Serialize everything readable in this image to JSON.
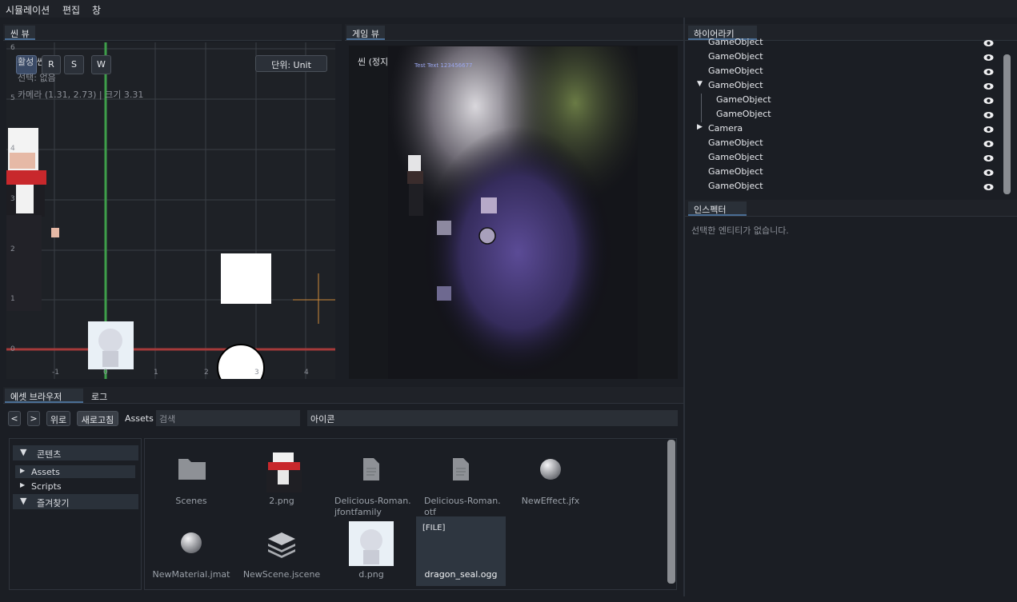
{
  "menubar": {
    "items": [
      "시뮬레이션",
      "편집",
      "창"
    ]
  },
  "scene_view": {
    "tab": "씬 뷰",
    "buttons": [
      "R",
      "S",
      "W"
    ],
    "active_scene_label": "활성 씬",
    "selection_label": "선택: 없음",
    "camera_label": "카메라 (1.31, 2.73) | 크기 3.31",
    "unit_button": "단위: Unit",
    "y_ticks": [
      "6",
      "5",
      "4",
      "3",
      "2",
      "1",
      "0"
    ],
    "x_ticks": [
      "-1",
      "0",
      "1",
      "2",
      "3",
      "4"
    ],
    "axis_colors": {
      "x_axis": "#a63a3a",
      "y_axis": "#3e9e4a",
      "gizmo": "#d08a3a"
    }
  },
  "game_view": {
    "tab": "게임 뷰",
    "status": "씬 (정지)",
    "overlay_text": "Test Text 123456677"
  },
  "hierarchy": {
    "tab": "하이어라키",
    "items": [
      {
        "label": "GameObject",
        "indent": 0,
        "arrow": ""
      },
      {
        "label": "GameObject",
        "indent": 0,
        "arrow": ""
      },
      {
        "label": "GameObject",
        "indent": 0,
        "arrow": ""
      },
      {
        "label": "GameObject",
        "indent": 0,
        "arrow": "▼"
      },
      {
        "label": "GameObject",
        "indent": 1,
        "arrow": ""
      },
      {
        "label": "GameObject",
        "indent": 1,
        "arrow": ""
      },
      {
        "label": "Camera",
        "indent": 0,
        "arrow": "▶"
      },
      {
        "label": "GameObject",
        "indent": 0,
        "arrow": ""
      },
      {
        "label": "GameObject",
        "indent": 0,
        "arrow": ""
      },
      {
        "label": "GameObject",
        "indent": 0,
        "arrow": ""
      },
      {
        "label": "GameObject",
        "indent": 0,
        "arrow": ""
      }
    ]
  },
  "inspector": {
    "tab": "인스펙터",
    "empty_text": "선택한 엔티티가 없습니다."
  },
  "asset_browser": {
    "tabs": [
      "에셋 브라우저",
      "로그"
    ],
    "toolbar": {
      "back": "<",
      "forward": ">",
      "up": "위로",
      "refresh": "새로고침",
      "path": "Assets",
      "search_placeholder": "검색",
      "view_mode": "아이콘"
    },
    "tree": {
      "content_header": "콘텐츠",
      "content_items": [
        "Assets",
        "Scripts"
      ],
      "favorites_header": "즐겨찾기"
    },
    "files": [
      {
        "name": "Scenes",
        "icon": "folder-icon"
      },
      {
        "name": "2.png",
        "icon": "character-thumbnail"
      },
      {
        "name": "Delicious-Roman.\njfontfamily",
        "icon": "document-icon"
      },
      {
        "name": "Delicious-Roman.\notf",
        "icon": "document-icon"
      },
      {
        "name": "NewEffect.jfx",
        "icon": "sphere-icon"
      },
      {
        "name": "NewMaterial.jmat",
        "icon": "sphere-icon"
      },
      {
        "name": "NewScene.jscene",
        "icon": "layers-icon"
      },
      {
        "name": "d.png",
        "icon": "cat-thumbnail"
      },
      {
        "name": "dragon_seal.ogg",
        "icon": "file-tile",
        "tag": "[FILE]"
      }
    ]
  }
}
